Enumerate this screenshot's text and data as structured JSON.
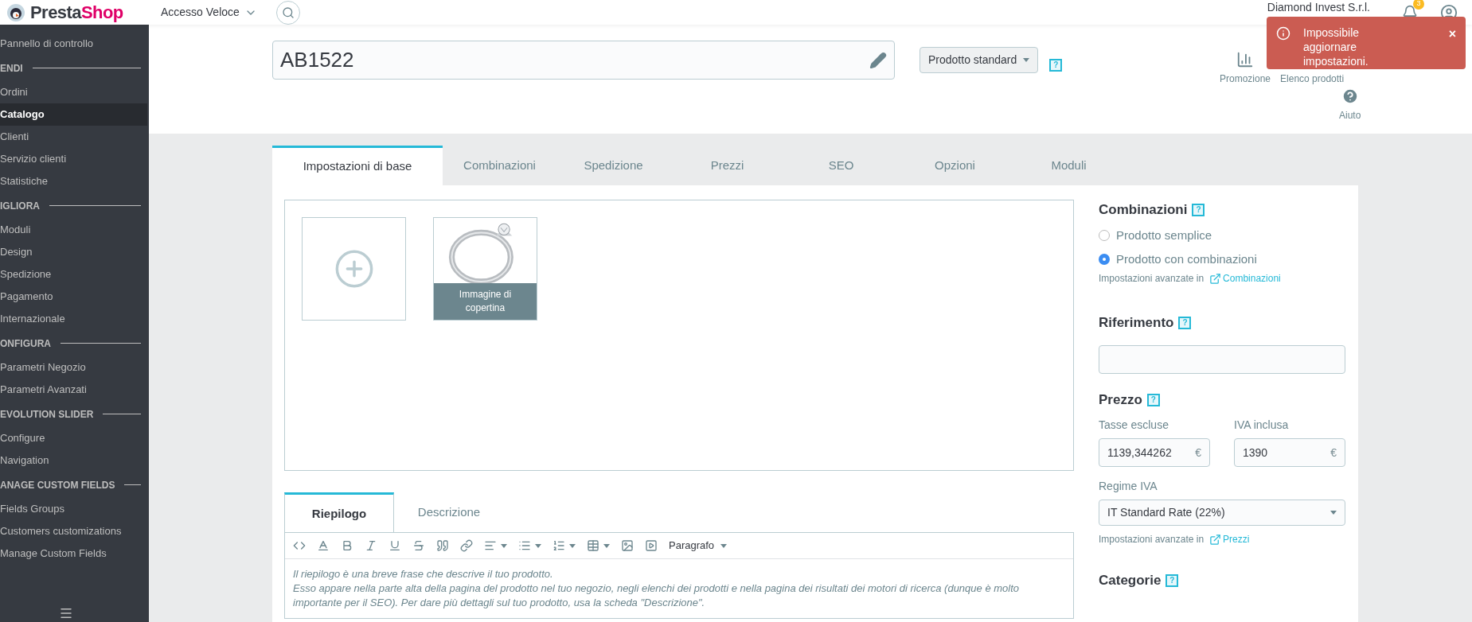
{
  "header": {
    "logo": {
      "first": "Presta",
      "second": "Shop"
    },
    "quick_access": "Accesso Veloce",
    "shop_name": "Diamond Invest S.r.l.",
    "notifications": "3"
  },
  "toast": {
    "message": "Impossibile aggiornare impostazioni.",
    "close": "×"
  },
  "sidebar": {
    "groups": [
      {
        "items": [
          {
            "label": "Pannello di controllo",
            "selected": false
          }
        ]
      },
      {
        "title": "ENDI",
        "items": [
          {
            "label": "Ordini",
            "selected": false
          },
          {
            "label": "Catalogo",
            "selected": true
          },
          {
            "label": "Clienti",
            "selected": false
          },
          {
            "label": "Servizio clienti",
            "selected": false
          },
          {
            "label": "Statistiche",
            "selected": false
          }
        ]
      },
      {
        "title": "IGLIORA",
        "items": [
          {
            "label": "Moduli",
            "selected": false
          },
          {
            "label": "Design",
            "selected": false
          },
          {
            "label": "Spedizione",
            "selected": false
          },
          {
            "label": "Pagamento",
            "selected": false
          },
          {
            "label": "Internazionale",
            "selected": false
          }
        ]
      },
      {
        "title": "ONFIGURA",
        "items": [
          {
            "label": "Parametri Negozio",
            "selected": false
          },
          {
            "label": "Parametri Avanzati",
            "selected": false
          }
        ]
      },
      {
        "title": "EVOLUTION SLIDER",
        "items": [
          {
            "label": "Configure",
            "selected": false
          },
          {
            "label": "Navigation",
            "selected": false
          }
        ]
      },
      {
        "title": "ANAGE CUSTOM FIELDS",
        "items": [
          {
            "label": "Fields Groups",
            "selected": false
          },
          {
            "label": "Customers customizations",
            "selected": false
          },
          {
            "label": "Manage Custom Fields",
            "selected": false
          }
        ]
      }
    ]
  },
  "product": {
    "name": "AB1522",
    "type": "Prodotto standard",
    "help": "?"
  },
  "actions": [
    {
      "label": "Promozione",
      "kind": "stats"
    },
    {
      "label": "Elenco prodotti",
      "kind": "list"
    },
    {
      "label": "Aiuto",
      "kind": "help"
    }
  ],
  "tabs": [
    {
      "label": "Impostazioni di base",
      "selected": true
    },
    {
      "label": "Combinazioni",
      "selected": false
    },
    {
      "label": "Spedizione",
      "selected": false
    },
    {
      "label": "Prezzi",
      "selected": false
    },
    {
      "label": "SEO",
      "selected": false
    },
    {
      "label": "Opzioni",
      "selected": false
    },
    {
      "label": "Moduli",
      "selected": false
    }
  ],
  "images": [
    {
      "kind": "add"
    },
    {
      "kind": "picture",
      "caption": "Immagine di copertina"
    }
  ],
  "editor": {
    "tabs": [
      {
        "label": "Riepilogo",
        "selected": true
      },
      {
        "label": "Descrizione",
        "selected": false
      }
    ],
    "format": "Paragrafo",
    "paragraphs": [
      "Il riepilogo è una breve frase che descrive il tuo prodotto.",
      "Esso appare nella parte alta della pagina del prodotto nel tuo negozio, negli elenchi dei prodotti e nella pagina dei risultati dei motori di ricerca (dunque è molto importante per il SEO). Per dare più dettagli sul tuo prodotto, usa la scheda \"Descrizione\"."
    ]
  },
  "combinations": {
    "title": "Combinazioni",
    "help": "?",
    "options": [
      {
        "label": "Prodotto semplice",
        "selected": false
      },
      {
        "label": "Prodotto con combinazioni",
        "selected": true
      }
    ],
    "advanced": {
      "text": "Impostazioni avanzate in",
      "link": "Combinazioni"
    }
  },
  "reference": {
    "title": "Riferimento",
    "help": "?"
  },
  "price": {
    "title": "Prezzo",
    "help": "?",
    "fields": [
      {
        "label": "Tasse escluse",
        "value": "1139,344262",
        "currency": "€"
      },
      {
        "label": "IVA inclusa",
        "value": "1390",
        "currency": "€"
      }
    ],
    "regime": {
      "label": "Regime IVA",
      "value": "IT Standard Rate (22%)"
    },
    "advanced": {
      "text": "Impostazioni avanzate in",
      "link": "Prezzi"
    }
  },
  "categories": {
    "title": "Categorie",
    "help": "?"
  }
}
